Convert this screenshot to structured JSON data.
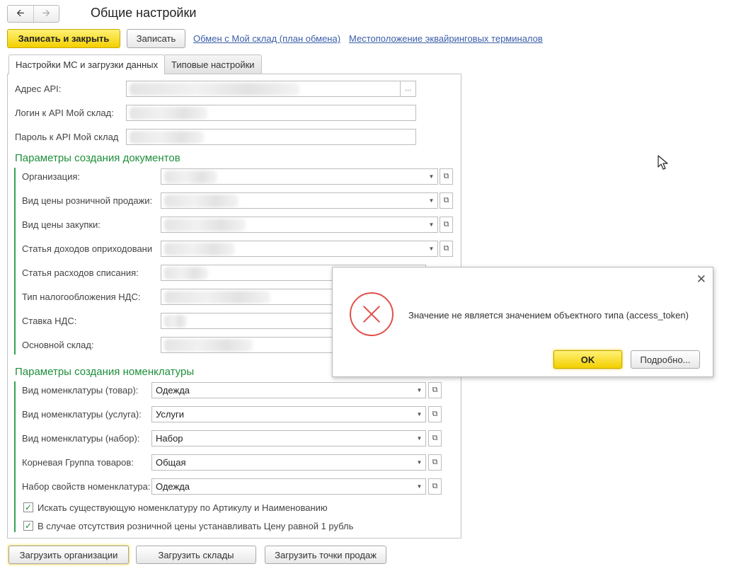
{
  "window": {
    "title": "Общие настройки",
    "nav_back_icon": "arrow-left-icon",
    "nav_forward_icon": "arrow-right-icon"
  },
  "toolbar": {
    "save_close_label": "Записать и закрыть",
    "save_label": "Записать",
    "link_exchange": "Обмен с Мой склад (план обмена)",
    "link_terminals": "Местоположение эквайринговых терминалов"
  },
  "tabs": [
    {
      "label": "Настройки МС и загрузки данных",
      "active": true
    },
    {
      "label": "Типовые настройки",
      "active": false
    }
  ],
  "api": {
    "address_label": "Адрес API:",
    "login_label": "Логин к API Мой склад:",
    "password_label": "Пароль к API Мой склад"
  },
  "docs_section": {
    "title": "Параметры создания документов",
    "fields": [
      {
        "label": "Организация:"
      },
      {
        "label": "Вид цены розничной продажи:"
      },
      {
        "label": "Вид цены закупки:"
      },
      {
        "label": "Статья доходов оприходовани"
      },
      {
        "label": "Статья расходов списания:"
      },
      {
        "label": "Тип налогообложения НДС:"
      },
      {
        "label": "Ставка НДС:"
      },
      {
        "label": "Основной склад:"
      }
    ]
  },
  "nomen_section": {
    "title": "Параметры создания номенклатуры",
    "fields": [
      {
        "label": "Вид номенклатуры (товар):",
        "value": "Одежда"
      },
      {
        "label": "Вид номенклатуры (услуга):",
        "value": "Услуги"
      },
      {
        "label": "Вид номенклатуры (набор):",
        "value": "Набор"
      },
      {
        "label": "Корневая Группа товаров:",
        "value": "Общая"
      },
      {
        "label": "Набор свойств номенклатура:",
        "value": "Одежда"
      }
    ],
    "checkboxes": [
      {
        "label": "Искать существующую номенклатуру по Артикулу и Наименованию",
        "checked": true
      },
      {
        "label": "В случае отсутствия розничной цены устанавливать Цену равной 1 рубль",
        "checked": true
      }
    ]
  },
  "bottom_buttons": {
    "load_orgs": "Загрузить организации",
    "load_warehouses": "Загрузить склады",
    "load_points": "Загрузить точки продаж"
  },
  "dialog": {
    "message": "Значение не является значением объектного типа (access_token)",
    "ok_label": "OK",
    "details_label": "Подробно...",
    "error_icon": "error-circle-icon",
    "close_icon": "close-icon"
  }
}
